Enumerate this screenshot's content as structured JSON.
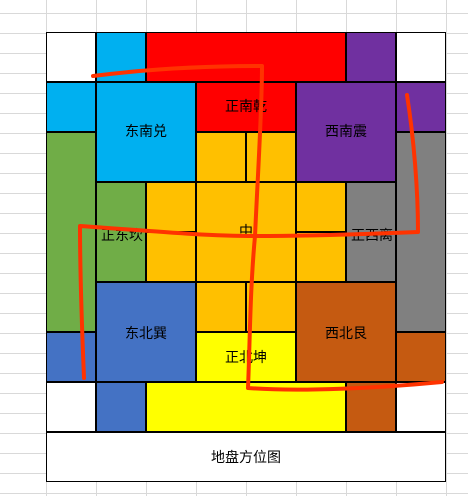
{
  "colors": {
    "white": "#ffffff",
    "blue_light": "#00b0f0",
    "red": "#ff0000",
    "purple": "#7030a0",
    "green": "#70ad47",
    "orange": "#ffc000",
    "gray": "#808080",
    "blue_dark": "#4472c4",
    "yellow": "#ffff00",
    "brown": "#c55a11",
    "ink": "#ff3300"
  },
  "labels": {
    "southeast": "东南兑",
    "south": "正南乾",
    "southwest": "西南震",
    "east": "正东坎",
    "center": "中",
    "west": "正西离",
    "northeast": "东北巽",
    "north": "正北坤",
    "northwest": "西北艮"
  },
  "caption": "地盘方位图"
}
